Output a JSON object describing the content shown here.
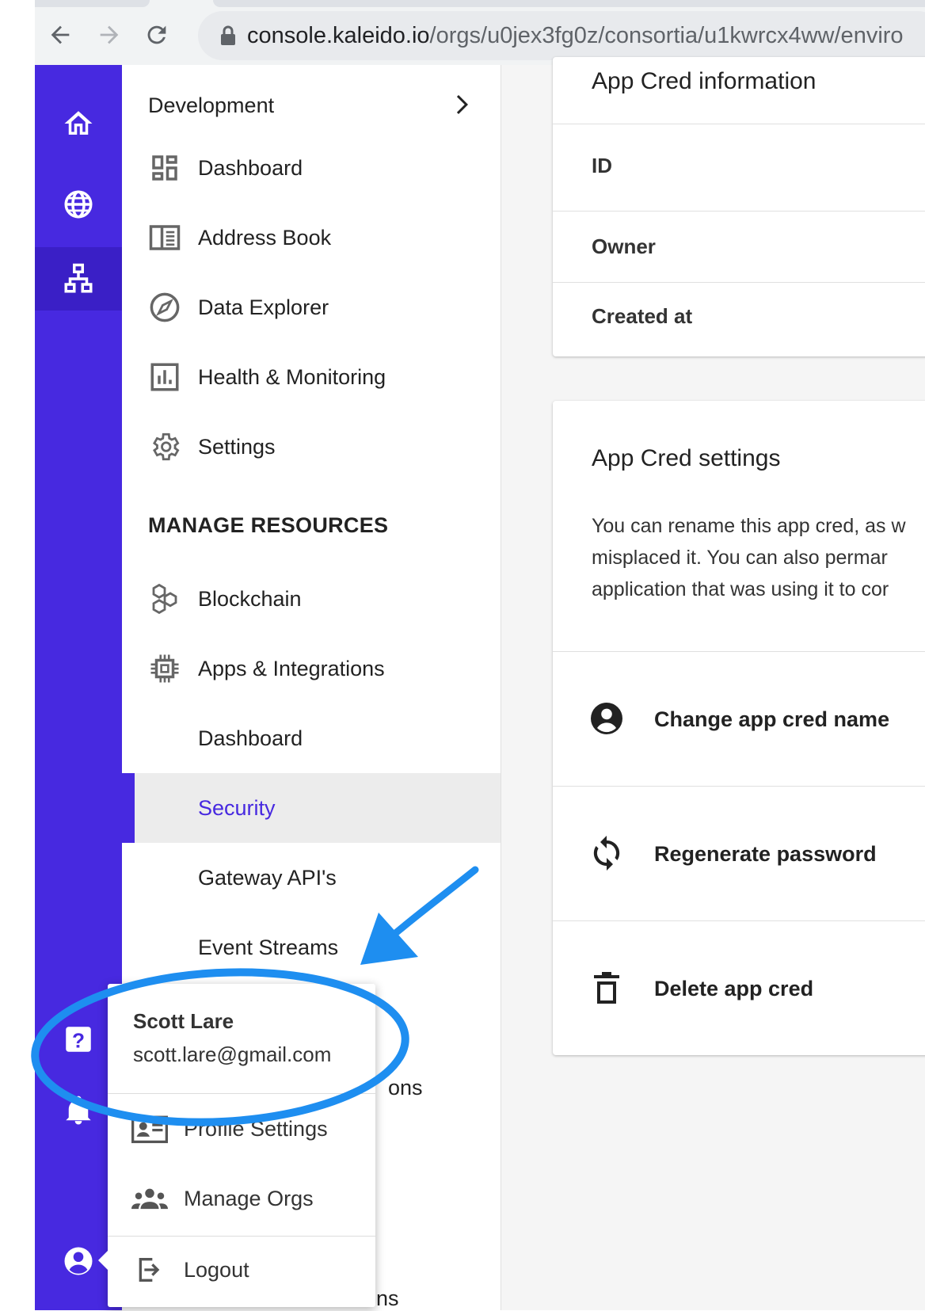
{
  "browser": {
    "url_host": "console.kaleido.io",
    "url_path": "/orgs/u0jex3fg0z/consortia/u1kwrcx4ww/enviro"
  },
  "drawer": {
    "header": "Development",
    "items": [
      {
        "label": "Dashboard",
        "icon": "dashboard-icon"
      },
      {
        "label": "Address Book",
        "icon": "address-book-icon"
      },
      {
        "label": "Data Explorer",
        "icon": "compass-icon"
      },
      {
        "label": "Health & Monitoring",
        "icon": "bar-chart-icon"
      },
      {
        "label": "Settings",
        "icon": "gear-icon"
      }
    ],
    "section": "MANAGE RESOURCES",
    "resources": [
      {
        "label": "Blockchain",
        "icon": "hexagons-icon"
      },
      {
        "label": "Apps & Integrations",
        "icon": "chip-icon"
      },
      {
        "label": "Dashboard"
      },
      {
        "label": "Security",
        "selected": true
      },
      {
        "label": "Gateway API's"
      },
      {
        "label": "Event Streams"
      }
    ],
    "peek": [
      "ons",
      "ons"
    ]
  },
  "main": {
    "info_card": {
      "title": "App Cred information",
      "rows": [
        "ID",
        "Owner",
        "Created at"
      ]
    },
    "settings_card": {
      "title": "App Cred settings",
      "description": [
        "You can rename this app cred, as w",
        "misplaced it. You can also permar",
        "application that was using it to cor"
      ],
      "actions": [
        {
          "label": "Change app cred name",
          "icon": "account-circle-icon"
        },
        {
          "label": "Regenerate password",
          "icon": "refresh-icon"
        },
        {
          "label": "Delete app cred",
          "icon": "trash-icon"
        }
      ]
    }
  },
  "user_menu": {
    "name": "Scott Lare",
    "email": "scott.lare@gmail.com",
    "items": [
      {
        "label": "Profile Settings",
        "icon": "profile-card-icon"
      },
      {
        "label": "Manage Orgs",
        "icon": "group-icon"
      },
      {
        "label": "Logout",
        "icon": "logout-icon"
      }
    ]
  },
  "colors": {
    "brand": "#4729e0",
    "annotation": "#1e8ef0"
  }
}
